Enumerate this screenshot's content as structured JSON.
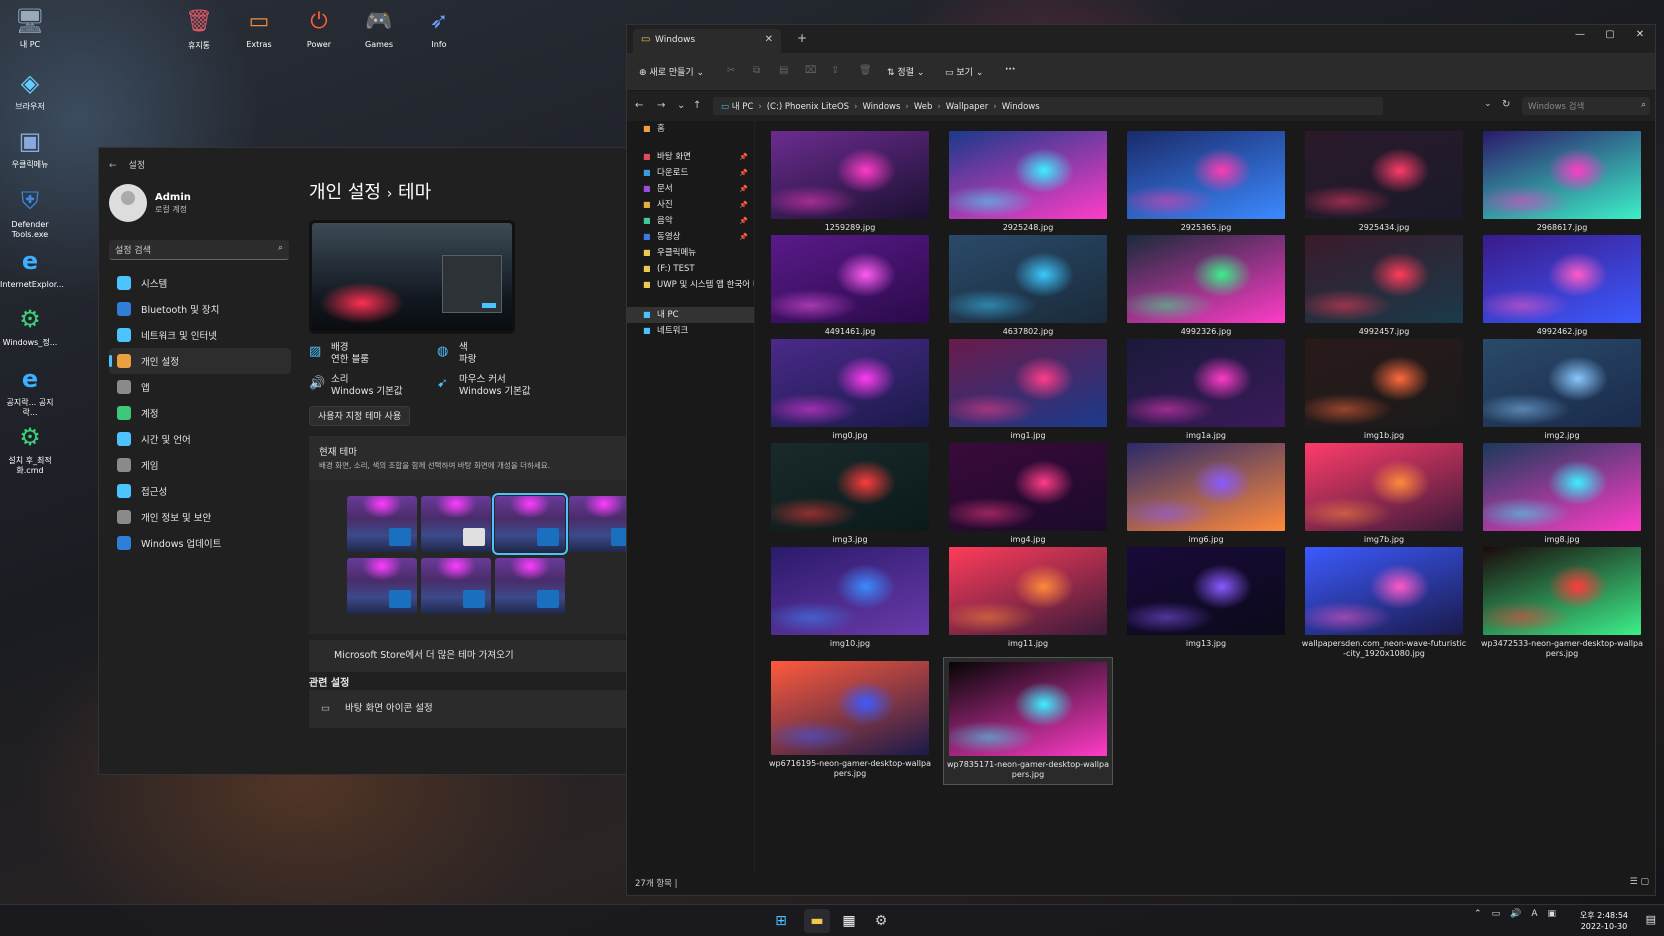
{
  "desktop": {
    "left_icons": [
      {
        "label": "내 PC",
        "icon": "monitor-icon"
      },
      {
        "label": "브라우저",
        "icon": "browser-icon"
      },
      {
        "label": "우클릭메뉴",
        "icon": "context-menu-icon"
      },
      {
        "label": "Defender Tools.exe",
        "icon": "shield-icon"
      },
      {
        "label": "InternetExplor...",
        "icon": "internet-explorer-icon"
      },
      {
        "label": "Windows_정...",
        "icon": "gear-icon"
      },
      {
        "label": "공지락... 공지락...",
        "icon": "internet-explorer-icon"
      },
      {
        "label": "설치 후_최적화.cmd",
        "icon": "gear-icon"
      }
    ],
    "top_icons": [
      {
        "label": "휴지통",
        "icon": "recycle-bin-icon"
      },
      {
        "label": "Extras",
        "icon": "folder-icon"
      },
      {
        "label": "Power",
        "icon": "power-icon"
      },
      {
        "label": "Games",
        "icon": "gamepad-icon"
      },
      {
        "label": "Info",
        "icon": "info-bird-icon"
      }
    ]
  },
  "settings": {
    "title": "설정",
    "user": {
      "name": "Admin",
      "type": "로컬 계정"
    },
    "search_placeholder": "설정 검색",
    "nav": [
      {
        "label": "시스템",
        "icon": "system-icon",
        "color": "#4cc2ff"
      },
      {
        "label": "Bluetooth 및 장치",
        "icon": "bluetooth-icon",
        "color": "#2f7fd8"
      },
      {
        "label": "네트워크 및 인터넷",
        "icon": "wifi-icon",
        "color": "#4cc2ff"
      },
      {
        "label": "개인 설정",
        "icon": "brush-icon",
        "color": "#e8a040",
        "active": true
      },
      {
        "label": "앱",
        "icon": "apps-icon",
        "color": "#8a8a8a"
      },
      {
        "label": "계정",
        "icon": "account-icon",
        "color": "#3ec97a"
      },
      {
        "label": "시간 및 언어",
        "icon": "globe-icon",
        "color": "#4cc2ff"
      },
      {
        "label": "게임",
        "icon": "gamepad-icon",
        "color": "#8a8a8a"
      },
      {
        "label": "접근성",
        "icon": "accessibility-icon",
        "color": "#4cc2ff"
      },
      {
        "label": "개인 정보 및 보안",
        "icon": "shield-icon",
        "color": "#8a8a8a"
      },
      {
        "label": "Windows 업데이트",
        "icon": "update-icon",
        "color": "#2f7fd8"
      }
    ],
    "breadcrumb": {
      "parent": "개인 설정",
      "sep": "›",
      "current": "테마"
    },
    "options": [
      {
        "label": "배경",
        "value": "연한 블룸",
        "icon": "image-icon"
      },
      {
        "label": "색",
        "value": "파랑",
        "icon": "palette-icon"
      },
      {
        "label": "소리",
        "value": "Windows 기본값",
        "icon": "sound-icon"
      },
      {
        "label": "마우스 커서",
        "value": "Windows 기본값",
        "icon": "cursor-icon"
      }
    ],
    "custom_theme_button": "사용자 지정 테마 사용",
    "current_theme_title": "현재 테마",
    "current_theme_desc": "배경 화면, 소리, 색의 조합을 함께 선택하여 바탕 화면에 개성을 더하세요.",
    "store_link": "Microsoft Store에서 더 많은 테마 가져오기",
    "related_title": "관련 설정",
    "related_item": "바탕 화면 아이콘 설정"
  },
  "explorer": {
    "tab_title": "Windows",
    "toolbar": {
      "new": "새로 만들기",
      "sort": "정렬",
      "view": "보기",
      "more": "···"
    },
    "path": [
      "내 PC",
      "(C:) Phoenix LiteOS",
      "Windows",
      "Web",
      "Wallpaper",
      "Windows"
    ],
    "search_placeholder": "Windows 검색",
    "sidebar": {
      "home": "홈",
      "quick": [
        {
          "label": "바탕 화면",
          "icon": "desktop-icon",
          "color": "#e04b5a"
        },
        {
          "label": "다운로드",
          "icon": "download-icon",
          "color": "#3c9be0"
        },
        {
          "label": "문서",
          "icon": "document-icon",
          "color": "#a04be0"
        },
        {
          "label": "사진",
          "icon": "picture-icon",
          "color": "#e0b040"
        },
        {
          "label": "음악",
          "icon": "music-icon",
          "color": "#3ec9a0"
        },
        {
          "label": "동영상",
          "icon": "video-icon",
          "color": "#3c7be0"
        }
      ],
      "extra": [
        {
          "label": "우클릭메뉴",
          "icon": "folder-icon",
          "color": "#f2c94c"
        },
        {
          "label": "(F:) TEST",
          "icon": "folder-icon",
          "color": "#f2c94c"
        },
        {
          "label": "UWP 및 시스템 앱 한국어 미",
          "icon": "folder-icon",
          "color": "#f2c94c"
        }
      ],
      "pc": "내 PC",
      "network": "네트워크"
    },
    "files": [
      {
        "name": "1259289.jpg",
        "colors": [
          "#6b2c8f",
          "#ff3cc8",
          "#1a1030"
        ]
      },
      {
        "name": "2925248.jpg",
        "colors": [
          "#1a3a8a",
          "#3cf0ff",
          "#ff3cc8"
        ]
      },
      {
        "name": "2925365.jpg",
        "colors": [
          "#1a2a6a",
          "#ff3cb0",
          "#3c8aff"
        ]
      },
      {
        "name": "2925434.jpg",
        "colors": [
          "#2a1a2a",
          "#ff3c6a",
          "#1a1a2a"
        ]
      },
      {
        "name": "2968617.jpg",
        "colors": [
          "#2a1a6a",
          "#ff3cc8",
          "#3cf0c8"
        ]
      },
      {
        "name": "4491461.jpg",
        "colors": [
          "#5a1a8a",
          "#ff5cf0",
          "#2a0a4a"
        ]
      },
      {
        "name": "4637802.jpg",
        "colors": [
          "#2a4a6a",
          "#3cc8ff",
          "#1a2a3a"
        ]
      },
      {
        "name": "4992326.jpg",
        "colors": [
          "#1a2a3a",
          "#3cf08a",
          "#ff3cc8"
        ]
      },
      {
        "name": "4992457.jpg",
        "colors": [
          "#3a1a2a",
          "#ff3c5a",
          "#1a3a4a"
        ]
      },
      {
        "name": "4992462.jpg",
        "colors": [
          "#3a1a8a",
          "#ff5cc8",
          "#3c5aff"
        ]
      },
      {
        "name": "img0.jpg",
        "colors": [
          "#4a2a8a",
          "#ff3cf0",
          "#1a1a4a"
        ]
      },
      {
        "name": "img1.jpg",
        "colors": [
          "#6a1a4a",
          "#ff3c8a",
          "#1a3a8a"
        ]
      },
      {
        "name": "img1a.jpg",
        "colors": [
          "#1a1a3a",
          "#ff3cc8",
          "#3a1a5a"
        ]
      },
      {
        "name": "img1b.jpg",
        "colors": [
          "#2a1a1a",
          "#ff6a3c",
          "#1a1a1a"
        ]
      },
      {
        "name": "img2.jpg",
        "colors": [
          "#2a4a6a",
          "#8ac8ff",
          "#1a2a4a"
        ]
      },
      {
        "name": "img3.jpg",
        "colors": [
          "#1a2a2a",
          "#ff3c3c",
          "#0a1a1a"
        ]
      },
      {
        "name": "img4.jpg",
        "colors": [
          "#3a0a3a",
          "#ff3c8a",
          "#1a0a2a"
        ]
      },
      {
        "name": "img6.jpg",
        "colors": [
          "#2a2a6a",
          "#8a5aff",
          "#ff8a3c"
        ]
      },
      {
        "name": "img7b.jpg",
        "colors": [
          "#ff3c6a",
          "#ff8a3c",
          "#3a1a3a"
        ]
      },
      {
        "name": "img8.jpg",
        "colors": [
          "#1a3a5a",
          "#3cf0ff",
          "#ff3cc8"
        ]
      },
      {
        "name": "img10.jpg",
        "colors": [
          "#2a1a6a",
          "#3c8aff",
          "#6a3aaa"
        ]
      },
      {
        "name": "img11.jpg",
        "colors": [
          "#ff3c5a",
          "#ff8a3c",
          "#3a1a3a"
        ]
      },
      {
        "name": "img13.jpg",
        "colors": [
          "#1a0a3a",
          "#8a5aff",
          "#0a0a1a"
        ]
      },
      {
        "name": "wallpapersden.com_neon-wave-futuristic-city_1920x1080.jpg",
        "colors": [
          "#3c5aff",
          "#ff5ac8",
          "#1a1a4a"
        ]
      },
      {
        "name": "wp3472533-neon-gamer-desktop-wallpapers.jpg",
        "colors": [
          "#1a0a0a",
          "#ff3c3c",
          "#3cf08a"
        ]
      },
      {
        "name": "wp6716195-neon-gamer-desktop-wallpapers.jpg",
        "colors": [
          "#ff5a3c",
          "#3c5aff",
          "#1a1a4a"
        ]
      },
      {
        "name": "wp7835171-neon-gamer-desktop-wallpapers.jpg",
        "colors": [
          "#050505",
          "#3cf0ff",
          "#ff3cc8"
        ]
      }
    ],
    "status": "27개 항목  |"
  },
  "taskbar": {
    "clock_time": "오후 2:48:54",
    "clock_date": "2022-10-30",
    "items": [
      {
        "icon": "start-icon",
        "color": "#4cc2ff"
      },
      {
        "icon": "file-explorer-icon",
        "color": "#f2c94c"
      },
      {
        "icon": "store-icon",
        "color": "#fff"
      },
      {
        "icon": "settings-icon",
        "color": "#ccc"
      }
    ]
  }
}
